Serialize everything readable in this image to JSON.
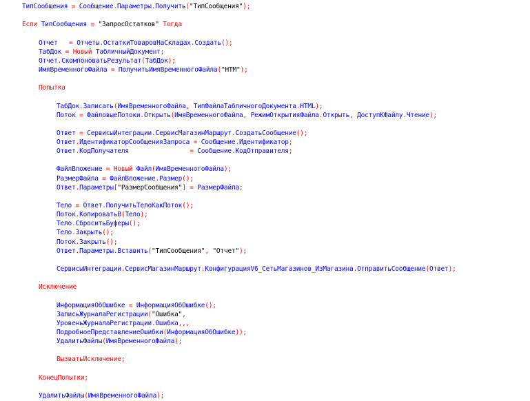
{
  "lines": [
    [
      [
        "id",
        "ТипСообщения"
      ],
      [
        "op",
        " = "
      ],
      [
        "id",
        "Сообщение"
      ],
      [
        "op",
        "."
      ],
      [
        "id",
        "Параметры"
      ],
      [
        "op",
        "."
      ],
      [
        "id",
        "Получить"
      ],
      [
        "pn",
        "("
      ],
      [
        "str",
        "\"ТипСообщения\""
      ],
      [
        "pn",
        ");"
      ]
    ],
    [],
    [
      [
        "kw",
        "Если "
      ],
      [
        "id",
        "ТипСообщения"
      ],
      [
        "op",
        " = "
      ],
      [
        "str",
        "\"ЗапросОстатков\""
      ],
      [
        "kw",
        " Тогда"
      ]
    ],
    [],
    [
      [
        "id",
        "Отчет"
      ],
      [
        "op",
        "   = "
      ],
      [
        "id",
        "Отчеты"
      ],
      [
        "op",
        "."
      ],
      [
        "id",
        "ОстаткиТоваровНаСкладах"
      ],
      [
        "op",
        "."
      ],
      [
        "id",
        "Создать"
      ],
      [
        "pn",
        "();"
      ]
    ],
    [
      [
        "id",
        "ТабДок"
      ],
      [
        "op",
        " = "
      ],
      [
        "kw",
        "Новый "
      ],
      [
        "id",
        "ТабличныйДокумент"
      ],
      [
        "pn",
        ";"
      ]
    ],
    [
      [
        "id",
        "Отчет"
      ],
      [
        "op",
        "."
      ],
      [
        "id",
        "СкомпоноватьРезультат"
      ],
      [
        "pn",
        "("
      ],
      [
        "id",
        "ТабДок"
      ],
      [
        "pn",
        ");"
      ]
    ],
    [
      [
        "id",
        "ИмяВременногоФайла"
      ],
      [
        "op",
        " = "
      ],
      [
        "id",
        "ПолучитьИмяВременногоФайла"
      ],
      [
        "pn",
        "("
      ],
      [
        "str",
        "\"HTM\""
      ],
      [
        "pn",
        ");"
      ]
    ],
    [],
    [
      [
        "kw",
        "Попытка"
      ]
    ],
    [],
    [
      [
        "id",
        "ТабДок"
      ],
      [
        "op",
        "."
      ],
      [
        "id",
        "Записать"
      ],
      [
        "pn",
        "("
      ],
      [
        "id",
        "ИмяВременногоФайла"
      ],
      [
        "pn",
        ", "
      ],
      [
        "id",
        "ТипФайлаТабличногоДокумента"
      ],
      [
        "op",
        "."
      ],
      [
        "id",
        "HTML"
      ],
      [
        "pn",
        ");"
      ]
    ],
    [
      [
        "id",
        "Поток"
      ],
      [
        "op",
        " = "
      ],
      [
        "id",
        "ФайловыеПотоки"
      ],
      [
        "op",
        "."
      ],
      [
        "id",
        "Открыть"
      ],
      [
        "pn",
        "("
      ],
      [
        "id",
        "ИмяВременногоФайла"
      ],
      [
        "pn",
        ", "
      ],
      [
        "id",
        "РежимОткрытияФайла"
      ],
      [
        "op",
        "."
      ],
      [
        "id",
        "Открыть"
      ],
      [
        "pn",
        ", "
      ],
      [
        "id",
        "ДоступКФайлу"
      ],
      [
        "op",
        "."
      ],
      [
        "id",
        "Чтение"
      ],
      [
        "pn",
        ");"
      ]
    ],
    [],
    [
      [
        "id",
        "Ответ"
      ],
      [
        "op",
        " = "
      ],
      [
        "id",
        "СервисыИнтеграции"
      ],
      [
        "op",
        "."
      ],
      [
        "id",
        "СервисМагазинМаршрут"
      ],
      [
        "op",
        "."
      ],
      [
        "id",
        "СоздатьСообщение"
      ],
      [
        "pn",
        "();"
      ]
    ],
    [
      [
        "id",
        "Ответ"
      ],
      [
        "op",
        "."
      ],
      [
        "id",
        "ИдентификаторСообщенияЗапроса"
      ],
      [
        "op",
        " = "
      ],
      [
        "id",
        "Сообщение"
      ],
      [
        "op",
        "."
      ],
      [
        "id",
        "Идентификатор"
      ],
      [
        "pn",
        ";"
      ]
    ],
    [
      [
        "id",
        "Ответ"
      ],
      [
        "op",
        "."
      ],
      [
        "id",
        "КодПолучателя"
      ],
      [
        "op",
        "                = "
      ],
      [
        "id",
        "Сообщение"
      ],
      [
        "op",
        "."
      ],
      [
        "id",
        "КодОтправителя"
      ],
      [
        "pn",
        ";"
      ]
    ],
    [],
    [
      [
        "id",
        "ФайлВложение"
      ],
      [
        "op",
        " = "
      ],
      [
        "kw",
        "Новый "
      ],
      [
        "id",
        "Файл"
      ],
      [
        "pn",
        "("
      ],
      [
        "id",
        "ИмяВременногоФайла"
      ],
      [
        "pn",
        ");"
      ]
    ],
    [
      [
        "id",
        "РазмерФайла"
      ],
      [
        "op",
        " = "
      ],
      [
        "id",
        "ФайлВложение"
      ],
      [
        "op",
        "."
      ],
      [
        "id",
        "Размер"
      ],
      [
        "pn",
        "();"
      ]
    ],
    [
      [
        "id",
        "Ответ"
      ],
      [
        "op",
        "."
      ],
      [
        "id",
        "Параметры"
      ],
      [
        "pn",
        "["
      ],
      [
        "str",
        "\"РазмерСообщения\""
      ],
      [
        "pn",
        "]"
      ],
      [
        "op",
        " = "
      ],
      [
        "id",
        "РазмерФайла"
      ],
      [
        "pn",
        ";"
      ]
    ],
    [],
    [
      [
        "id",
        "Тело"
      ],
      [
        "op",
        " = "
      ],
      [
        "id",
        "Ответ"
      ],
      [
        "op",
        "."
      ],
      [
        "id",
        "ПолучитьТелоКакПоток"
      ],
      [
        "pn",
        "();"
      ]
    ],
    [
      [
        "id",
        "Поток"
      ],
      [
        "op",
        "."
      ],
      [
        "id",
        "КопироватьВ"
      ],
      [
        "pn",
        "("
      ],
      [
        "id",
        "Тело"
      ],
      [
        "pn",
        ");"
      ]
    ],
    [
      [
        "id",
        "Тело"
      ],
      [
        "op",
        "."
      ],
      [
        "id",
        "СброситьБуферы"
      ],
      [
        "pn",
        "();"
      ]
    ],
    [
      [
        "id",
        "Тело"
      ],
      [
        "op",
        "."
      ],
      [
        "id",
        "Закрыть"
      ],
      [
        "pn",
        "();"
      ]
    ],
    [
      [
        "id",
        "Поток"
      ],
      [
        "op",
        "."
      ],
      [
        "id",
        "Закрыть"
      ],
      [
        "pn",
        "();"
      ]
    ],
    [
      [
        "id",
        "Ответ"
      ],
      [
        "op",
        "."
      ],
      [
        "id",
        "Параметры"
      ],
      [
        "op",
        "."
      ],
      [
        "id",
        "Вставить"
      ],
      [
        "pn",
        "("
      ],
      [
        "str",
        "\"ТипСообщения\""
      ],
      [
        "pn",
        ", "
      ],
      [
        "str",
        "\"Отчет\""
      ],
      [
        "pn",
        ");"
      ]
    ],
    [],
    [
      [
        "id",
        "СервисыИнтеграции"
      ],
      [
        "op",
        "."
      ],
      [
        "id",
        "СервисМагазинМаршрут"
      ],
      [
        "op",
        "."
      ],
      [
        "id",
        "КонфигурацияV6_СетьМагазинов_ИзМагазина"
      ],
      [
        "op",
        "."
      ],
      [
        "id",
        "ОтправитьСообщение"
      ],
      [
        "pn",
        "("
      ],
      [
        "id",
        "Ответ"
      ],
      [
        "pn",
        ");"
      ]
    ],
    [],
    [
      [
        "kw",
        "Исключение"
      ]
    ],
    [],
    [
      [
        "id",
        "ИнформацияОбОшибке"
      ],
      [
        "op",
        " = "
      ],
      [
        "id",
        "ИнформацияОбОшибке"
      ],
      [
        "pn",
        "();"
      ]
    ],
    [
      [
        "id",
        "ЗаписьЖурналаРегистрации"
      ],
      [
        "pn",
        "("
      ],
      [
        "str",
        "\"Ошибка\""
      ],
      [
        "pn",
        ","
      ]
    ],
    [
      [
        "id",
        "УровеньЖурналаРегистрации"
      ],
      [
        "op",
        "."
      ],
      [
        "id",
        "Ошибка"
      ],
      [
        "pn",
        ",,,"
      ]
    ],
    [
      [
        "id",
        "ПодробноеПредставлениеОшибки"
      ],
      [
        "pn",
        "("
      ],
      [
        "id",
        "ИнформацияОбОшибке"
      ],
      [
        "pn",
        "));"
      ]
    ],
    [
      [
        "id",
        "УдалитьФайлы"
      ],
      [
        "pn",
        "("
      ],
      [
        "id",
        "ИмяВременногоФайла"
      ],
      [
        "pn",
        ");"
      ]
    ],
    [],
    [
      [
        "kw",
        "ВызватьИсключение"
      ],
      [
        "pn",
        ";"
      ]
    ],
    [],
    [
      [
        "kw",
        "КонецПопытки"
      ],
      [
        "pn",
        ";"
      ]
    ],
    [],
    [
      [
        "id",
        "УдалитьФайлы"
      ],
      [
        "pn",
        "("
      ],
      [
        "id",
        "ИмяВременногоФайла"
      ],
      [
        "pn",
        ");"
      ]
    ]
  ]
}
